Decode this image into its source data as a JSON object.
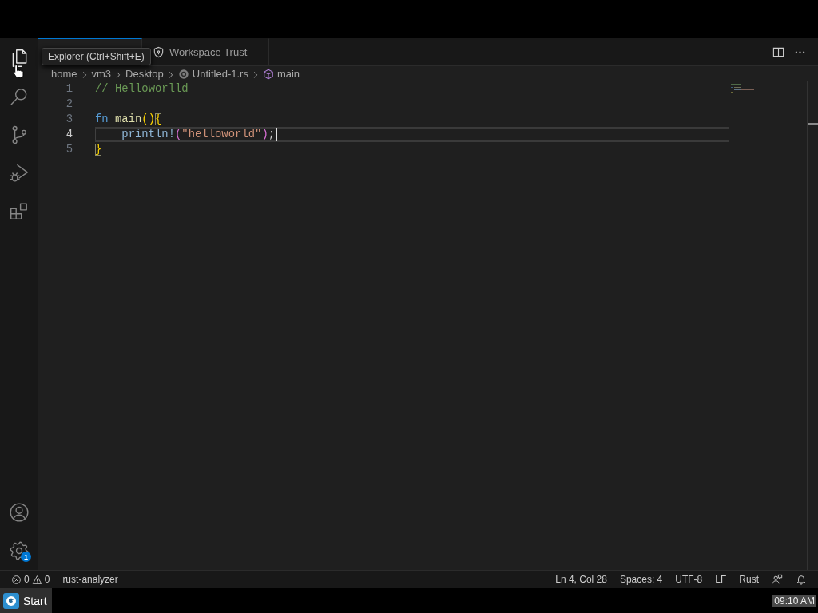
{
  "window": {
    "activity_bar": {
      "top": [
        {
          "kind": "explorer",
          "hovered": true
        },
        {
          "kind": "search",
          "hovered": false
        },
        {
          "kind": "source_control",
          "hovered": false
        },
        {
          "kind": "run_debug",
          "hovered": false
        },
        {
          "kind": "extensions",
          "hovered": false
        }
      ],
      "bottom": [
        {
          "kind": "accounts"
        },
        {
          "kind": "manage",
          "badge": "1"
        }
      ]
    },
    "tooltip": {
      "text": "Explorer (Ctrl+Shift+E)"
    },
    "tabs": [
      {
        "selected": true
      },
      {
        "label": "Workspace Trust",
        "selected": false
      }
    ],
    "breadcrumbs": [
      {
        "label": "home",
        "kind": "folder"
      },
      {
        "label": "vm3",
        "kind": "folder"
      },
      {
        "label": "Desktop",
        "kind": "folder"
      },
      {
        "label": "Untitled-1.rs",
        "kind": "file"
      },
      {
        "label": "main",
        "kind": "symbol"
      }
    ],
    "editor": {
      "lines": [
        {
          "number": "1",
          "current": false,
          "indented": false,
          "cursor": false,
          "tokens": [
            {
              "text": "// Helloworlld",
              "kind": "comment"
            }
          ]
        },
        {
          "number": "2",
          "current": false,
          "indented": false,
          "cursor": false
        },
        {
          "number": "3",
          "current": false,
          "indented": false,
          "cursor": false,
          "tokens": [
            {
              "text": "fn",
              "kind": "keyword",
              "space_after": true
            },
            {
              "text": "main",
              "kind": "function"
            },
            {
              "text": "()",
              "kind": "bracket"
            },
            {
              "text": "{",
              "kind": "bracket",
              "matched": true
            }
          ]
        },
        {
          "number": "4",
          "current": true,
          "indented": true,
          "cursor": true,
          "tokens": [
            {
              "text": "println!",
              "kind": "macro"
            },
            {
              "text": "(",
              "kind": "bracket_nested"
            },
            {
              "text": "\"helloworld\"",
              "kind": "string"
            },
            {
              "text": ")",
              "kind": "bracket_nested"
            },
            {
              "text": ";",
              "kind": "punct"
            }
          ]
        },
        {
          "number": "5",
          "current": false,
          "indented": false,
          "cursor": false,
          "tokens": [
            {
              "text": "}",
              "kind": "bracket",
              "matched": true
            }
          ]
        }
      ]
    },
    "status_bar": {
      "errors": "0",
      "warnings": "0",
      "left_items": [
        "rust-analyzer"
      ],
      "right_items": [
        "Ln 4, Col 28",
        "Spaces: 4",
        "UTF-8",
        "LF",
        "Rust"
      ]
    }
  },
  "taskbar": {
    "start_label": "Start",
    "clock": "09:10 AM"
  }
}
